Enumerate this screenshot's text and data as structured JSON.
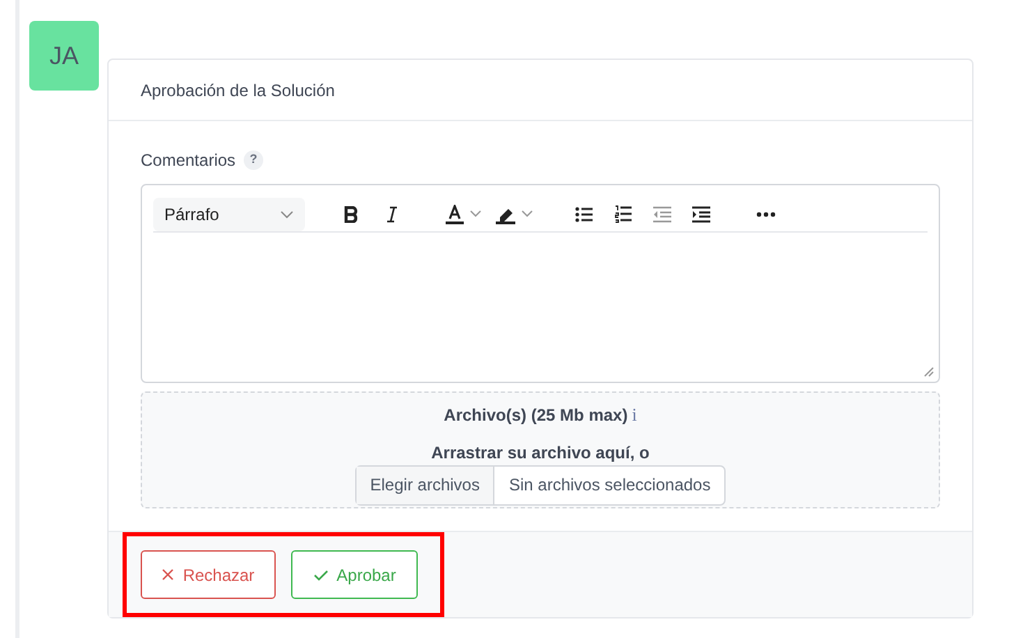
{
  "avatar": {
    "initials": "JA"
  },
  "card": {
    "title": "Aprobación de la Solución"
  },
  "comments": {
    "label": "Comentarios",
    "help": "?"
  },
  "editor": {
    "block_format": "Párrafo",
    "tools": [
      {
        "kind": "bold"
      },
      {
        "kind": "italic"
      },
      {
        "kind": "text-color"
      },
      {
        "kind": "highlight"
      },
      {
        "kind": "bullet-list"
      },
      {
        "kind": "numbered-list"
      },
      {
        "kind": "outdent"
      },
      {
        "kind": "indent"
      },
      {
        "kind": "more"
      }
    ]
  },
  "upload": {
    "label": "Archivo(s) (25 Mb max)",
    "info": "i",
    "hint": "Arrastrar su archivo aquí, o",
    "button": "Elegir archivos",
    "status": "Sin archivos seleccionados"
  },
  "actions": {
    "highlighted": true,
    "buttons": [
      {
        "kind": "reject",
        "label": "Rechazar"
      },
      {
        "kind": "approve",
        "label": "Aprobar"
      }
    ]
  }
}
